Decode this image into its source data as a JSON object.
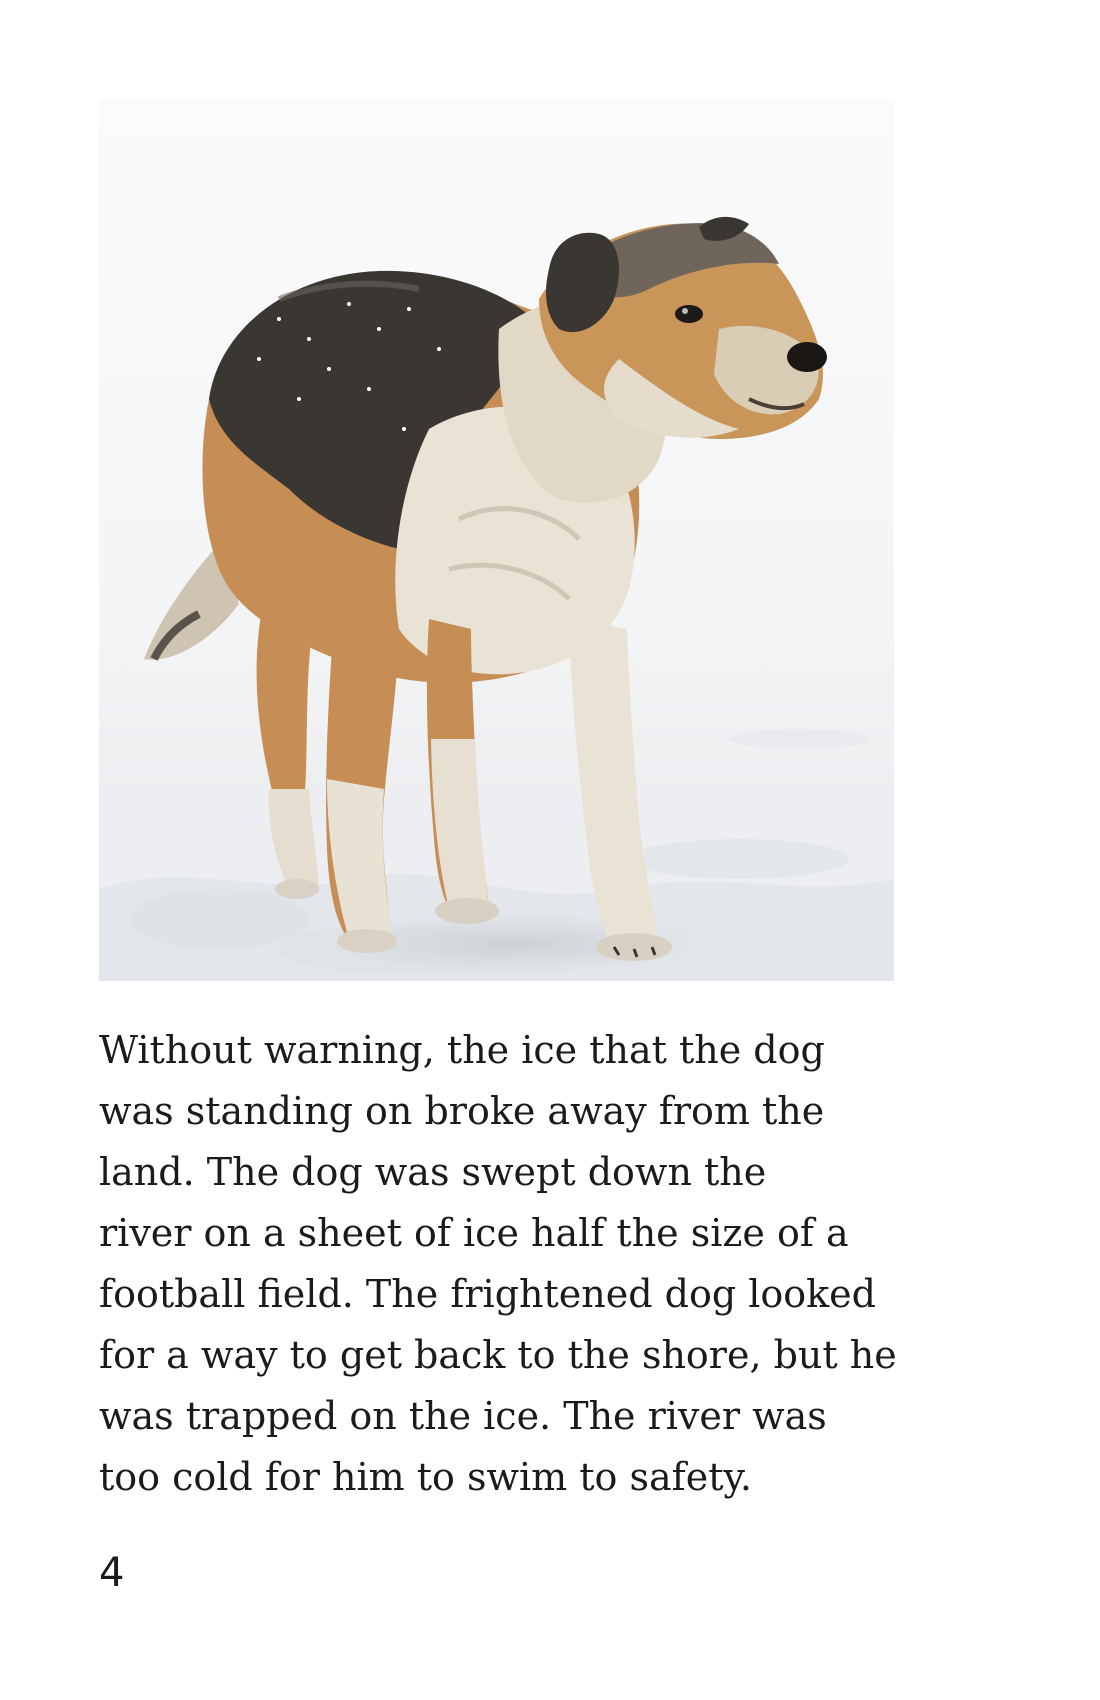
{
  "page": {
    "photo_description_icon": "dog-standing-in-snow-photo",
    "text_lines": [
      "Without warning, the ice that the dog",
      "was standing on broke away from the",
      "land. The dog was swept down the",
      "river on a sheet of ice half the size of a",
      "football field. The frightened dog looked",
      "for a way to get back to the shore, but he",
      "was trapped on the ice. The river was",
      "too cold for him to swim to safety."
    ],
    "page_number": "4"
  },
  "colors": {
    "text": "#1b1b1b",
    "snow": "#f4f5f6",
    "fur_tan": "#c8935a",
    "fur_dark": "#3a3632",
    "fur_cream": "#e9e3d6"
  }
}
